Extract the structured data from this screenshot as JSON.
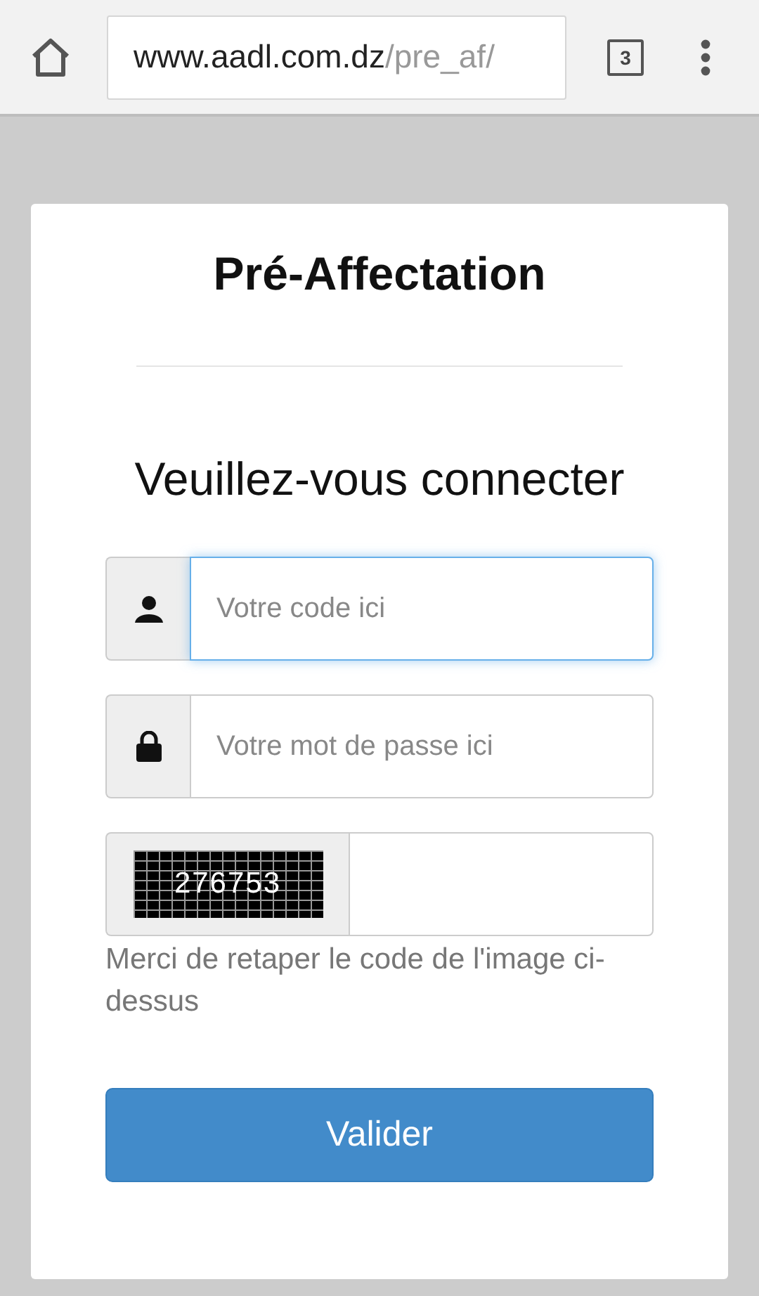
{
  "browser": {
    "url_host": "www.aadl.com.dz",
    "url_path": "/pre_af/",
    "tab_count": "3"
  },
  "form": {
    "title": "Pré-Affectation",
    "heading": "Veuillez-vous connecter",
    "fields": [
      {
        "kind": "user",
        "placeholder": "Votre code ici",
        "focused": true
      },
      {
        "kind": "password",
        "placeholder": "Votre mot de passe ici",
        "focused": false
      },
      {
        "kind": "captcha",
        "code": "276753",
        "focused": false
      }
    ],
    "help": "Merci de retaper le code de l'image ci-dessus",
    "submit": "Valider"
  }
}
